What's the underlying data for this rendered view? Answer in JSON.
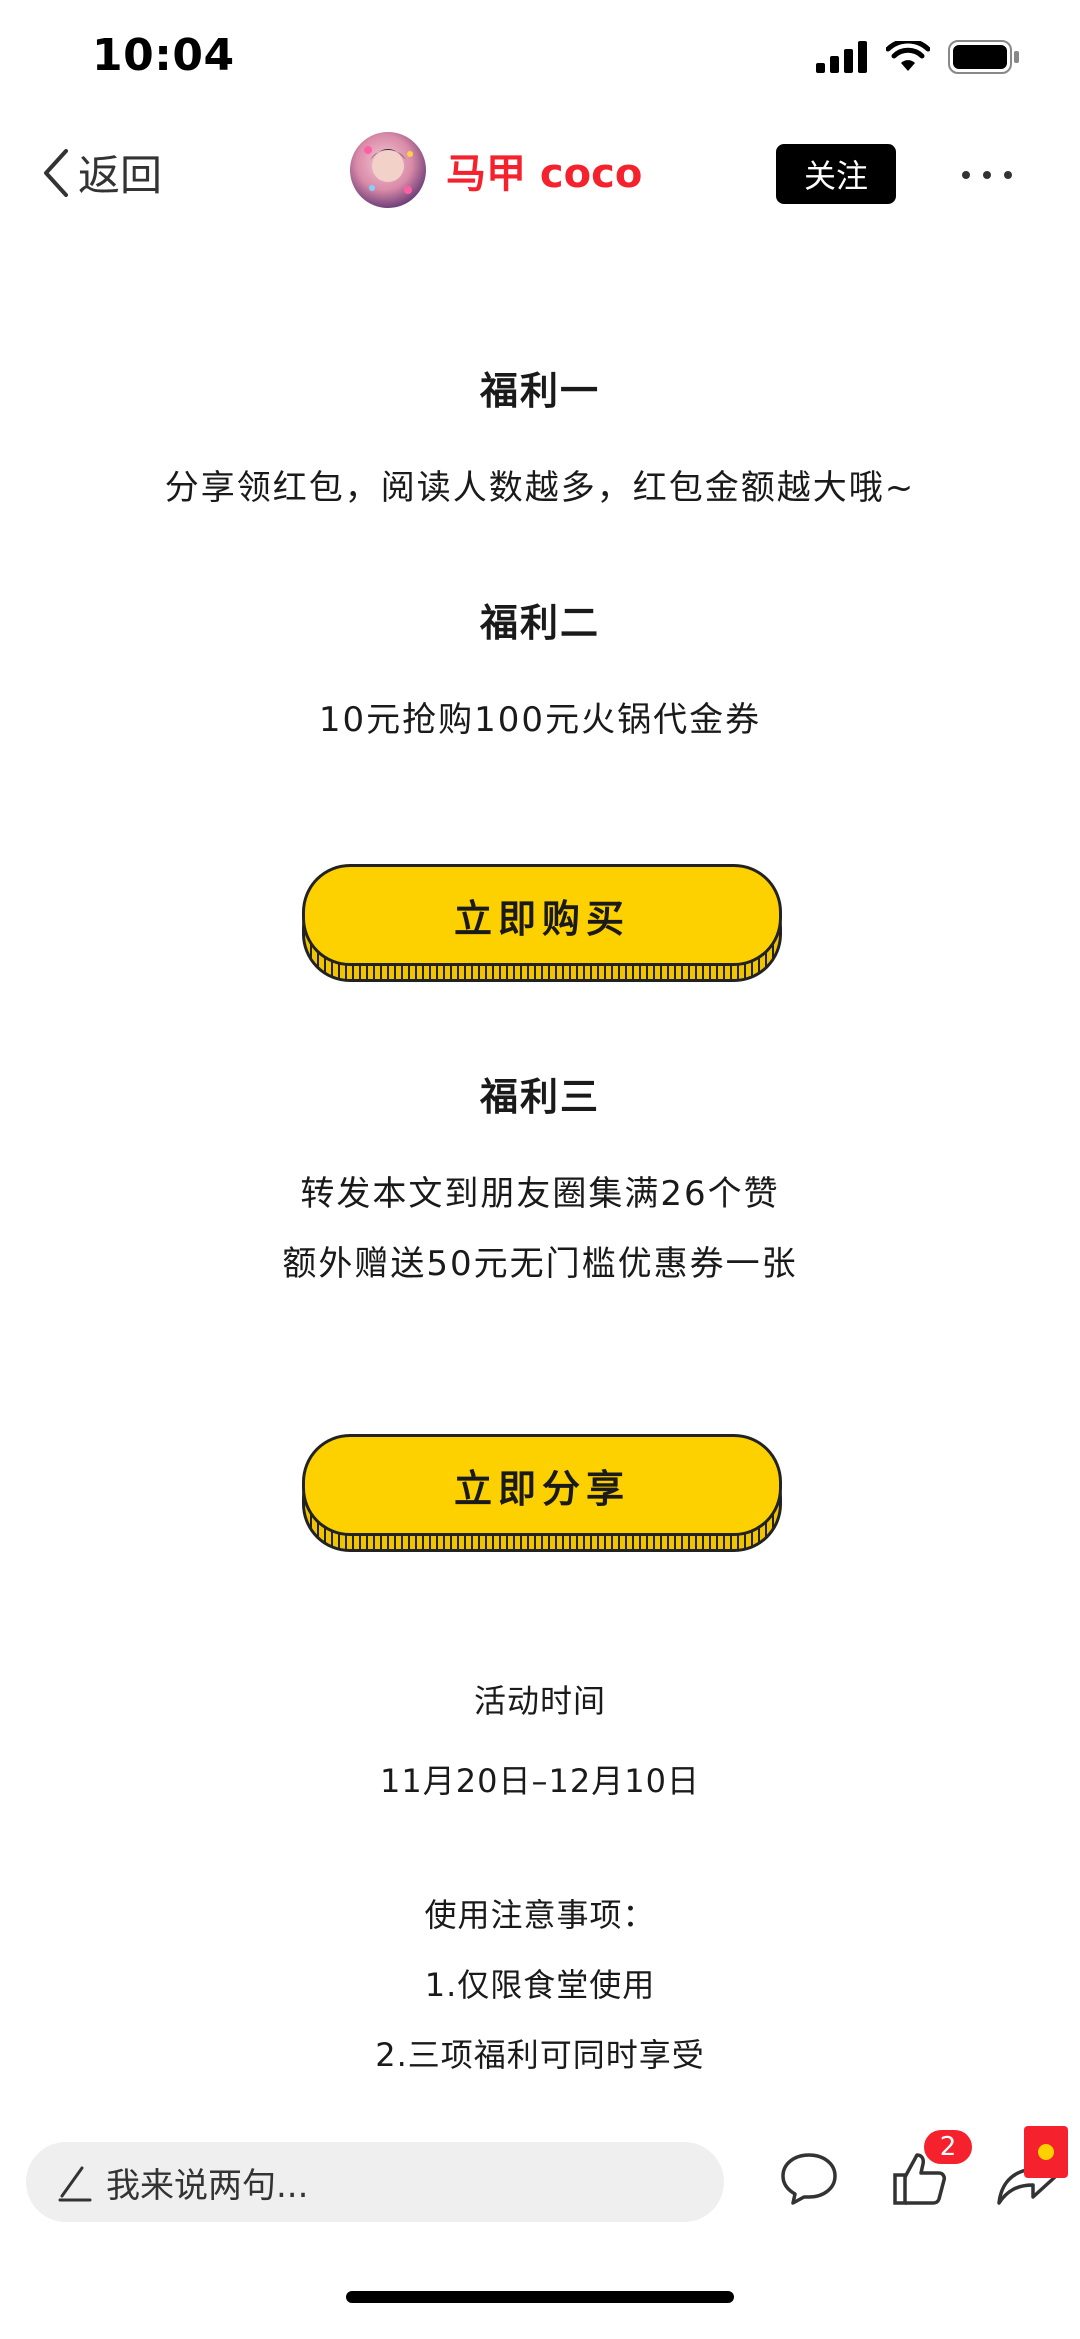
{
  "status_bar": {
    "time": "10:04"
  },
  "nav": {
    "back_label": "返回",
    "author_name": "马甲 coco",
    "follow_label": "关注"
  },
  "content": {
    "benefit1_title": "福利一",
    "benefit1_text": "分享领红包，阅读人数越多，红包金额越大哦~",
    "benefit2_title": "福利二",
    "benefit2_text": "10元抢购100元火锅代金券",
    "buy_button": "立即购买",
    "benefit3_title": "福利三",
    "benefit3_line1": "转发本文到朋友圈集满26个赞",
    "benefit3_line2": "额外赠送50元无门槛优惠券一张",
    "share_button": "立即分享",
    "activity_label": "活动时间",
    "activity_dates": "11月20日–12月10日",
    "notes_title": "使用注意事项：",
    "note1": "1.仅限食堂使用",
    "note2": "2.三项福利可同时享受"
  },
  "bottom_bar": {
    "comment_placeholder": "我来说两句...",
    "like_count": "2"
  },
  "colors": {
    "accent_yellow": "#fdd000",
    "author_red": "#f5222d",
    "follow_black": "#000000"
  },
  "icons": [
    "back-chevron-icon",
    "more-icon",
    "pencil-icon",
    "comment-icon",
    "like-icon",
    "share-icon",
    "red-packet-icon",
    "signal-icon",
    "wifi-icon",
    "battery-icon"
  ]
}
